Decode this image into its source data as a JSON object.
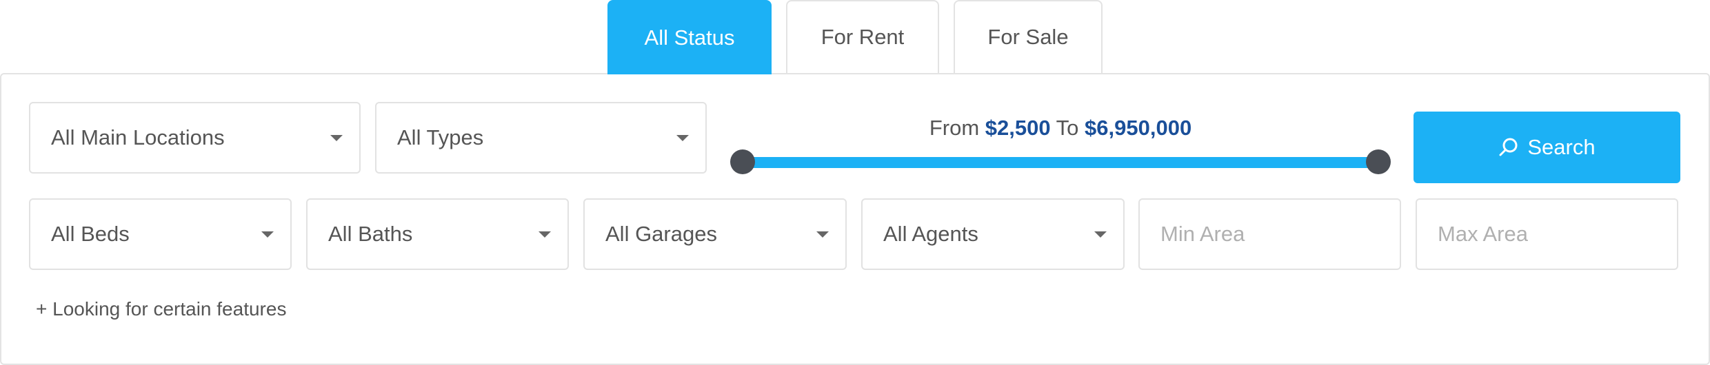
{
  "tabs": [
    {
      "label": "All Status",
      "active": true
    },
    {
      "label": "For Rent",
      "active": false
    },
    {
      "label": "For Sale",
      "active": false
    }
  ],
  "filters": {
    "location": "All Main Locations",
    "type": "All Types",
    "beds": "All Beds",
    "baths": "All Baths",
    "garages": "All Garages",
    "agents": "All Agents",
    "min_area_placeholder": "Min Area",
    "max_area_placeholder": "Max Area"
  },
  "price": {
    "from_label": "From",
    "min": "$2,500",
    "to_label": "To",
    "max": "$6,950,000"
  },
  "search": {
    "label": "Search",
    "icon": "search-icon"
  },
  "features_link": "+ Looking for certain features",
  "colors": {
    "accent": "#1cb1f5",
    "price_amount": "#1a4f99",
    "slider_handle": "#4a4e55"
  }
}
